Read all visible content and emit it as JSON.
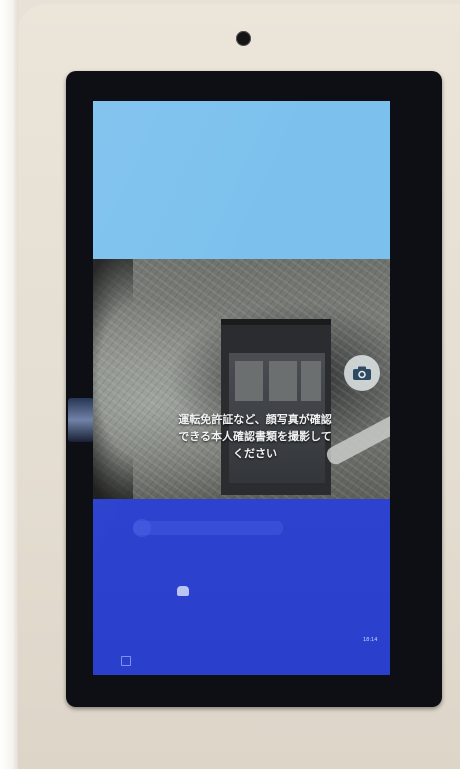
{
  "kiosk": {
    "camera_screen": {
      "instruction_lines": [
        "運転免許証など、顔写真が確認",
        "できる本人確認書類を撮影して",
        "ください"
      ],
      "shutter_icon": "camera-icon"
    },
    "status_bar": {
      "time": "18:14"
    },
    "colors": {
      "top_panel": "#7cc1ee",
      "bottom_panel": "#2a40d0",
      "bezel": "#0e0f14",
      "body": "#e7e1d7"
    }
  }
}
